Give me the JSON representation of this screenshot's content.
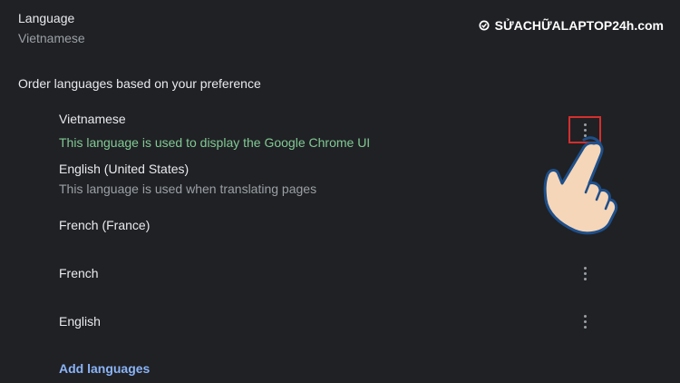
{
  "language_setting": {
    "title": "Language",
    "value": "Vietnamese"
  },
  "order_label": "Order languages based on your preference",
  "languages": [
    {
      "name": "Vietnamese",
      "description": "This language is used to display the Google Chrome UI",
      "description_color": "#81c995",
      "highlighted": true
    },
    {
      "name": "English (United States)",
      "description": "This language is used when translating pages",
      "description_color": "#9aa0a6",
      "highlighted": false
    },
    {
      "name": "French (France)",
      "description": "",
      "highlighted": false
    },
    {
      "name": "French",
      "description": "",
      "highlighted": false
    },
    {
      "name": "English",
      "description": "",
      "highlighted": false
    }
  ],
  "add_languages_label": "Add languages",
  "watermark": "SỬACHỮALAPTOP24h.com",
  "colors": {
    "background": "#202124",
    "text_primary": "#e8eaed",
    "text_secondary": "#9aa0a6",
    "accent_green": "#81c995",
    "link_blue": "#8ab4f8",
    "highlight_red": "#d32f2f"
  },
  "icons": {
    "more_button": "more-vert-icon",
    "pointer": "pointing-hand-icon",
    "brand_logo": "gear-icon"
  }
}
